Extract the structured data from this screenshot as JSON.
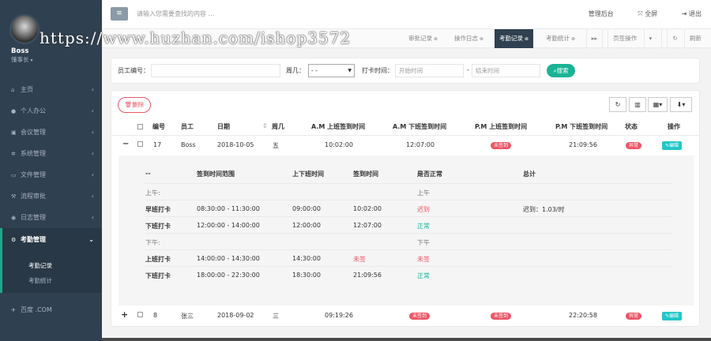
{
  "watermark": "https://www.huzhan.com/ishop3572",
  "profile": {
    "name": "Boss",
    "role": "懂事长"
  },
  "nav": [
    {
      "label": "主页",
      "icon": "home-icon"
    },
    {
      "label": "个人办公",
      "icon": "user-icon"
    },
    {
      "label": "会议管理",
      "icon": "meeting-icon"
    },
    {
      "label": "系统管理",
      "icon": "gear-icon"
    },
    {
      "label": "文件管理",
      "icon": "file-icon"
    },
    {
      "label": "流程审批",
      "icon": "gavel-icon"
    },
    {
      "label": "日志管理",
      "icon": "eye-icon"
    },
    {
      "label": "考勤管理",
      "icon": "cogs-icon"
    }
  ],
  "subnav": [
    "考勤记录",
    "考勤统计"
  ],
  "nav_extra": {
    "label": "百度 .COM",
    "icon": "plane-icon"
  },
  "topbar": {
    "search_placeholder": "请输入您需要查找的内容 …",
    "admin": "管理后台",
    "fullscreen": "全屏",
    "logout": "退出"
  },
  "tabs": [
    "审批记录",
    "操作日志",
    "考勤记录",
    "考勤统计"
  ],
  "tabs_right": {
    "page_ops": "页签操作",
    "refresh": "刷新"
  },
  "filter": {
    "emp_label": "员工编号：",
    "week_label": "周几：",
    "week_value": "- -",
    "time_label": "打卡时间：",
    "start_ph": "开始时间",
    "end_ph": "结束时间",
    "dash": "-",
    "search_btn": "搜索"
  },
  "toolbar": {
    "delete": "删除"
  },
  "table": {
    "headers": [
      "编号",
      "员工",
      "日期",
      "周几",
      "A.M 上班签到时间",
      "A.M 下班签到时间",
      "P.M 上班签到时间",
      "P.M 下班签到时间",
      "状态",
      "操作"
    ],
    "rows": [
      {
        "toggle": "−",
        "id": "17",
        "name": "Boss",
        "date": "2018-10-05",
        "week": "五",
        "am_in": "10:02:00",
        "am_out": "12:07:00",
        "pm_in": "未签到",
        "pm_out": "21:09:56",
        "status": "异常",
        "op": "编辑"
      },
      {
        "toggle": "+",
        "id": "8",
        "name": "张三",
        "date": "2018-09-02",
        "week": "三",
        "am_in": "09:19:26",
        "am_out": "未签到",
        "pm_in": "未签到",
        "pm_out": "22:20:58",
        "status": "异常",
        "op": "编辑"
      }
    ]
  },
  "detail": {
    "headers": [
      "--",
      "签到时间范围",
      "上下班时间",
      "签到时间",
      "是否正常",
      "总计"
    ],
    "rows": [
      {
        "a": "上午:",
        "b": "",
        "c": "",
        "d": "",
        "e": "上午",
        "e_cls": "gray",
        "f": ""
      },
      {
        "a": "早班打卡",
        "b": "08:30:00 - 11:30:00",
        "c": "09:00:00",
        "d": "10:02:00",
        "d_cls": "",
        "e": "迟到",
        "e_cls": "red",
        "f": "迟到：1.03/时"
      },
      {
        "a": "下班打卡",
        "b": "12:00:00 - 14:00:00",
        "c": "12:00:00",
        "d": "12:07:00",
        "d_cls": "",
        "e": "正常",
        "e_cls": "green",
        "f": ""
      },
      {
        "a": "下午:",
        "b": "",
        "c": "",
        "d": "",
        "e": "下午",
        "e_cls": "gray",
        "f": ""
      },
      {
        "a": "上班打卡",
        "b": "14:00:00 - 14:30:00",
        "c": "14:30:00",
        "d": "未签",
        "d_cls": "red",
        "e": "未签",
        "e_cls": "red",
        "f": ""
      },
      {
        "a": "下班打卡",
        "b": "18:00:00 - 22:30:00",
        "c": "18:30:00",
        "d": "21:09:56",
        "d_cls": "",
        "e": "正常",
        "e_cls": "green",
        "f": ""
      }
    ]
  },
  "colors": {
    "sidebar": "#2f4050",
    "accent": "#1ab394",
    "danger": "#ed5565",
    "info": "#23c6c8"
  }
}
